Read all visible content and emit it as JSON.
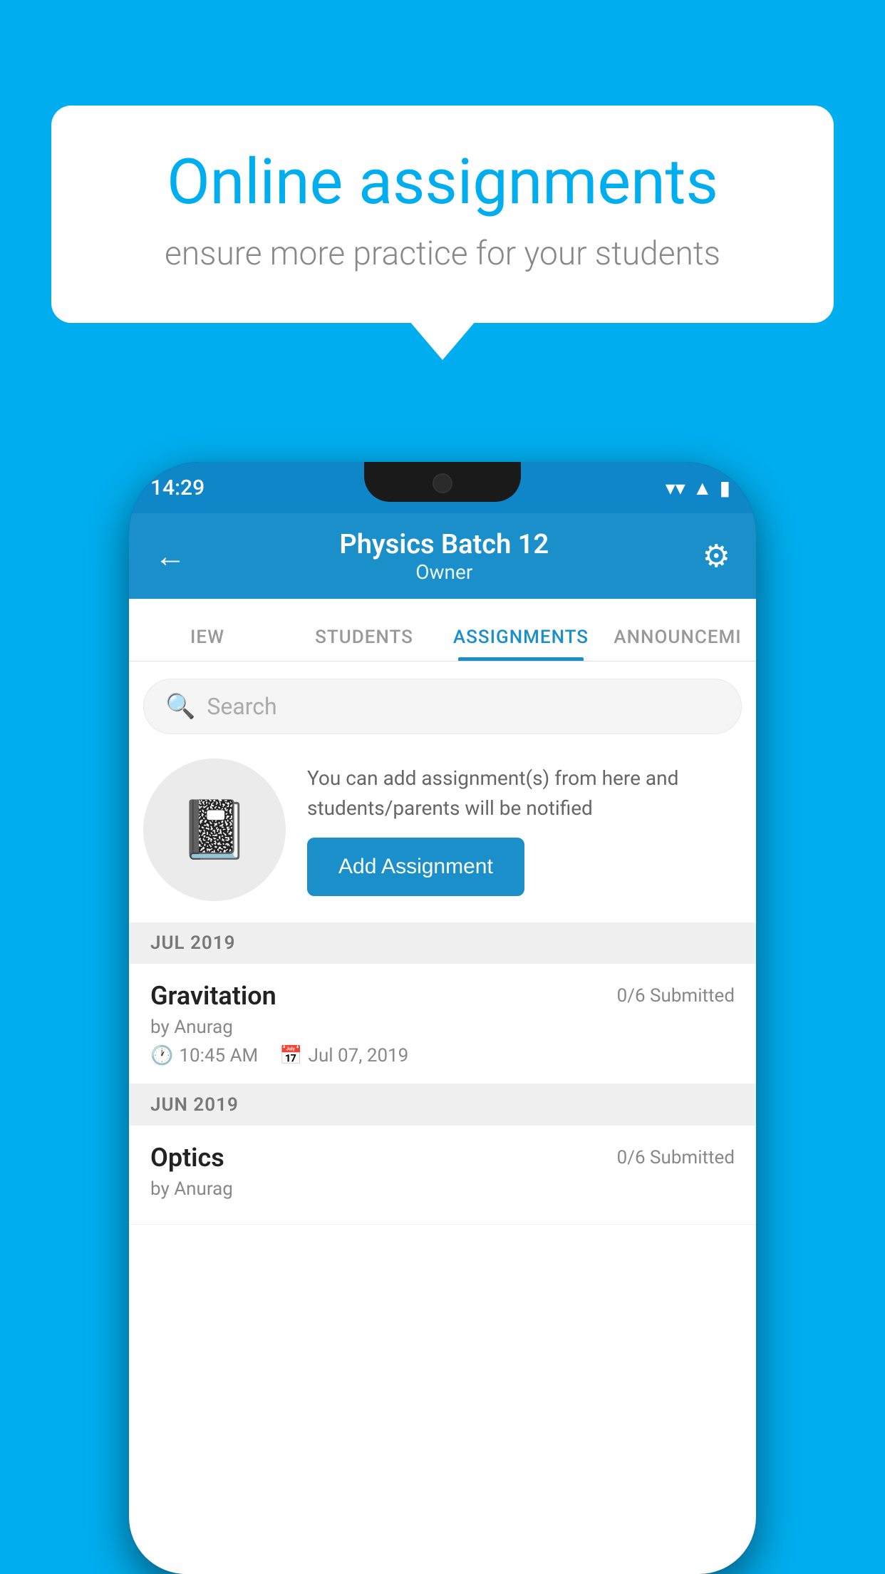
{
  "background_color": "#00AEEF",
  "speech_bubble": {
    "title": "Online assignments",
    "subtitle": "ensure more practice for your students"
  },
  "status_bar": {
    "time": "14:29",
    "wifi_icon": "▾",
    "signal_icon": "▲",
    "battery_icon": "▮"
  },
  "app_header": {
    "title": "Physics Batch 12",
    "subtitle": "Owner",
    "back_icon": "←",
    "gear_icon": "⚙"
  },
  "tabs": [
    {
      "label": "IEW",
      "active": false
    },
    {
      "label": "STUDENTS",
      "active": false
    },
    {
      "label": "ASSIGNMENTS",
      "active": true
    },
    {
      "label": "ANNOUNCEMI",
      "active": false
    }
  ],
  "search": {
    "placeholder": "Search"
  },
  "promo": {
    "description": "You can add assignment(s) from here and students/parents will be notified",
    "button_label": "Add Assignment"
  },
  "sections": [
    {
      "label": "JUL 2019",
      "assignments": [
        {
          "name": "Gravitation",
          "submitted": "0/6 Submitted",
          "by": "by Anurag",
          "time": "10:45 AM",
          "date": "Jul 07, 2019"
        }
      ]
    },
    {
      "label": "JUN 2019",
      "assignments": [
        {
          "name": "Optics",
          "submitted": "0/6 Submitted",
          "by": "by Anurag",
          "time": "",
          "date": ""
        }
      ]
    }
  ]
}
